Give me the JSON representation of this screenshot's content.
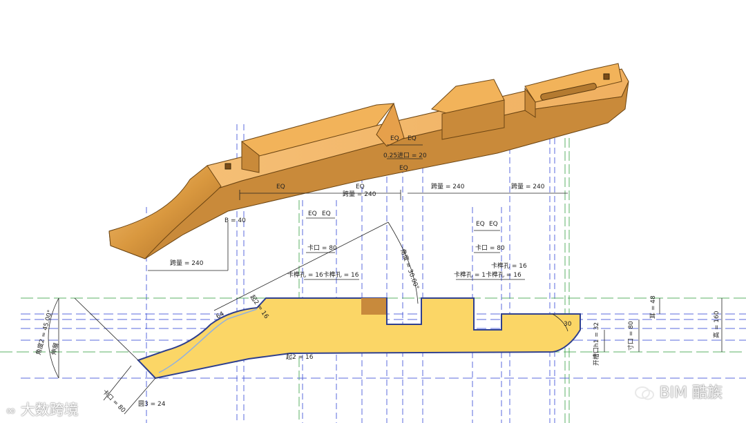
{
  "model_3d": {
    "dims": [
      {
        "id": "eq_1",
        "text": "EQ"
      },
      {
        "id": "eq_2",
        "text": "EQ"
      },
      {
        "id": "eq_top_a",
        "text": "EQ"
      },
      {
        "id": "eq_top_b",
        "text": "EQ"
      },
      {
        "id": "eq_top_c",
        "text": "EQ"
      },
      {
        "id": "slot_top",
        "text": "0.25进口 = 20"
      },
      {
        "id": "span_1",
        "text": "跨量 = 240"
      },
      {
        "id": "span_2",
        "text": "跨量 = 240"
      },
      {
        "id": "span_3",
        "text": "跨量 = 240"
      },
      {
        "id": "b40",
        "text": "B = 40"
      },
      {
        "id": "span_left",
        "text": "跨量 = 240"
      }
    ]
  },
  "profile_2d": {
    "dims": [
      {
        "id": "eq_l1",
        "text": "EQ"
      },
      {
        "id": "eq_l2",
        "text": "EQ"
      },
      {
        "id": "eq_r1",
        "text": "EQ"
      },
      {
        "id": "eq_r2",
        "text": "EQ"
      },
      {
        "id": "mouth_l",
        "text": "卡口 = 80"
      },
      {
        "id": "mouth_r",
        "text": "卡口 = 80"
      },
      {
        "id": "hole_r_top",
        "text": "卡榫孔 = 16"
      },
      {
        "id": "hole_l",
        "text": "卡榫孔 = 16卡榫孔 = 16"
      },
      {
        "id": "hole_r",
        "text": "卡榫孔 = 1卡榫孔 = 16"
      },
      {
        "id": "angle",
        "text": "角度 = 30.00°"
      },
      {
        "id": "angle2",
        "text": "角度2 = 45.00°"
      },
      {
        "id": "stretch",
        "text": "伸展"
      },
      {
        "id": "r16",
        "text": "起2 = 16"
      },
      {
        "id": "r64",
        "text": "64"
      },
      {
        "id": "bottom16",
        "text": "起2 = 16"
      },
      {
        "id": "r30",
        "text": "30"
      },
      {
        "id": "mouth_bottom",
        "text": "卡口 = 80"
      },
      {
        "id": "hole3",
        "text": "圆3 = 24"
      },
      {
        "id": "ear",
        "text": "耳 = 48"
      },
      {
        "id": "height",
        "text": "高 = 160"
      },
      {
        "id": "open_mouth",
        "text": "开槽口h1 = 32"
      },
      {
        "id": "scale_mouth",
        "text": "寸口 = 80"
      }
    ]
  },
  "watermarks": {
    "right": "BIM 酷族",
    "left": "大数跨境"
  },
  "colors": {
    "wood_light": "#f2b35a",
    "wood_dark": "#c98a3a",
    "profile_fill": "#fbd666",
    "profile_edge": "#2e3f8f",
    "ref_blue": "#3b4fd6",
    "ref_green": "#3fa34a",
    "square_hole": "#c88a3c"
  }
}
